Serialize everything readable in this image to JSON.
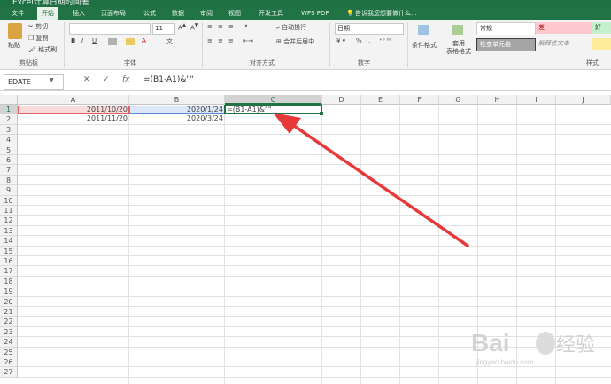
{
  "window": {
    "title": "Excel计算日期时间差"
  },
  "menu": {
    "tabs": [
      "文件",
      "开始",
      "插入",
      "页面布局",
      "公式",
      "数据",
      "审阅",
      "视图",
      "开发工具",
      "WPS PDF"
    ],
    "active_tab": "开始",
    "tell_me": "告诉我您想要做什么..."
  },
  "ribbon": {
    "clipboard": {
      "paste": "粘贴",
      "cut": "剪切",
      "copy": "复制",
      "format_painter": "格式刷",
      "label": "剪贴板"
    },
    "font": {
      "size": "11",
      "label": "字体"
    },
    "alignment": {
      "wrap": "自动换行",
      "merge": "合并后居中",
      "label": "对齐方式"
    },
    "number": {
      "format": "日期",
      "label": "数字"
    },
    "styles": {
      "conditional": "条件格式",
      "table": "套用",
      "table2": "表格格式",
      "normal": "常规",
      "bad": "差",
      "good": "好",
      "check_cell": "检查单元格",
      "explanatory": "解释性文本",
      "label": "样式"
    }
  },
  "formula_bar": {
    "name_box": "EDATE",
    "cancel": "✕",
    "enter": "✓",
    "fx": "fx",
    "formula": "=(B1-A1)&\"\""
  },
  "sheet": {
    "columns": [
      "A",
      "B",
      "C",
      "D",
      "E",
      "F",
      "G",
      "H",
      "I",
      "J"
    ],
    "selected_column": "C",
    "rows": [
      1,
      2,
      3,
      4,
      5,
      6,
      7,
      8,
      9,
      10,
      11,
      12,
      13,
      14,
      15,
      16,
      17,
      18,
      19,
      20,
      21,
      22,
      23,
      24,
      25,
      26,
      27
    ],
    "cells": {
      "A1": "2011/10/20",
      "B1": "2020/1/24",
      "C1": "=(B1-A1)&\"\"",
      "A2": "2011/11/20",
      "B2": "2020/3/24"
    }
  },
  "colors": {
    "excel_green": "#217346",
    "annotation_red": "#e8393a"
  }
}
